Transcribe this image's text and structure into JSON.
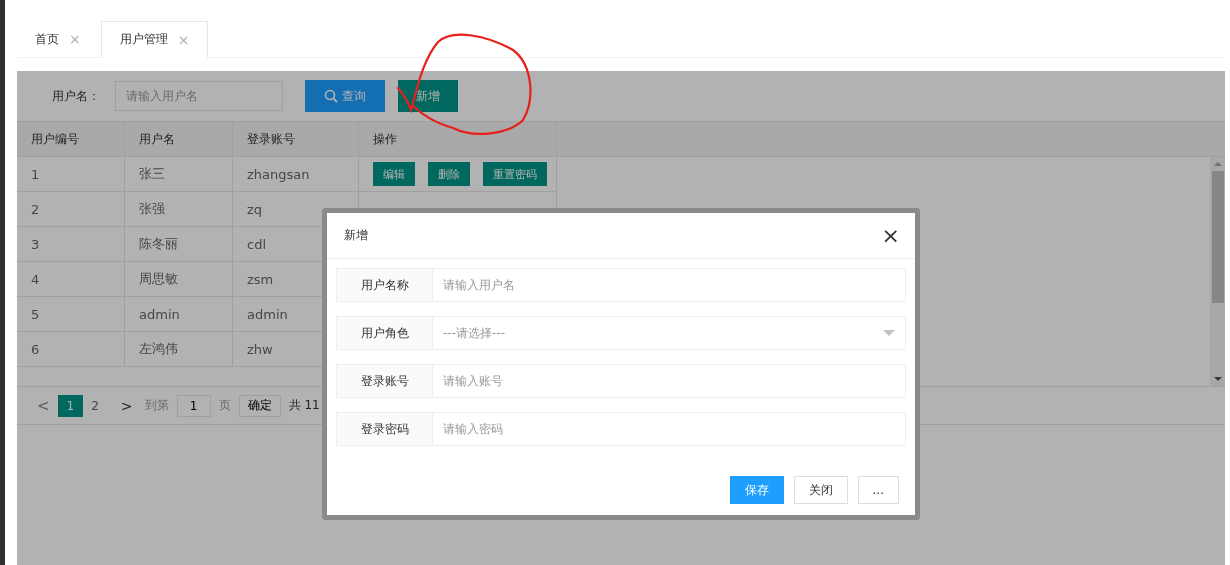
{
  "tabs": [
    {
      "label": "首页",
      "selected": false,
      "close": "×"
    },
    {
      "label": "用户管理",
      "selected": true,
      "close": "×"
    }
  ],
  "search": {
    "label": "用户名：",
    "placeholder": "请输入用户名",
    "buttons": [
      {
        "label": "查询",
        "kind": "search"
      },
      {
        "label": "新增",
        "kind": "add"
      }
    ]
  },
  "table": {
    "columns": [
      "用户编号",
      "用户名",
      "登录账号",
      "操作"
    ],
    "rows": [
      {
        "cells": [
          "1",
          "张三",
          "zhangsan"
        ],
        "actions": [
          "编辑",
          "删除",
          "重置密码"
        ]
      },
      {
        "cells": [
          "2",
          "张强",
          "zq"
        ]
      },
      {
        "cells": [
          "3",
          "陈冬丽",
          "cdl"
        ]
      },
      {
        "cells": [
          "4",
          "周思敏",
          "zsm"
        ]
      },
      {
        "cells": [
          "5",
          "admin",
          "admin"
        ]
      },
      {
        "cells": [
          "6",
          "左鸿伟",
          "zhw"
        ]
      }
    ]
  },
  "pagination": {
    "prev": "<",
    "pages": [
      {
        "label": "1",
        "selected": true
      },
      {
        "label": "2",
        "selected": false
      }
    ],
    "next": ">",
    "goto": "到第",
    "page_value": "1",
    "page_unit": "页",
    "confirm": "确定",
    "total": "共 11"
  },
  "dialog": {
    "title": "新增",
    "close": "×",
    "fields": [
      {
        "label": "用户名称",
        "kind": "input",
        "placeholder": "请输入用户名"
      },
      {
        "label": "用户角色",
        "kind": "select",
        "placeholder": "---请选择---"
      },
      {
        "label": "登录账号",
        "kind": "input",
        "placeholder": "请输入账号"
      },
      {
        "label": "登录密码",
        "kind": "input",
        "placeholder": "请输入密码"
      }
    ],
    "buttons": [
      {
        "label": "保存",
        "kind": "primary"
      },
      {
        "label": "关闭",
        "kind": "plain"
      },
      {
        "label": "...",
        "kind": "plain"
      }
    ]
  },
  "annotation": {
    "kind": "circle"
  }
}
